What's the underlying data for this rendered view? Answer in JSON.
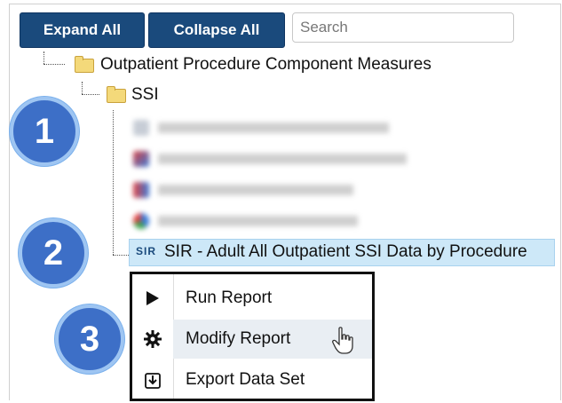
{
  "toolbar": {
    "expand_label": "Expand All",
    "collapse_label": "Collapse All",
    "search_placeholder": "Search"
  },
  "tree": {
    "root_label": "Outpatient Procedure Component Measures",
    "folder_label": "SSI",
    "selected_icon_text": "SIR",
    "selected_label": "SIR - Adult All Outpatient SSI Data by Procedure"
  },
  "context_menu": {
    "run": "Run Report",
    "modify": "Modify Report",
    "export": "Export Data Set"
  },
  "badges": {
    "one": "1",
    "two": "2",
    "three": "3"
  },
  "colors": {
    "button": "#1a4a7c",
    "badge": "#3d6fc7",
    "selection": "#cde8f8"
  }
}
